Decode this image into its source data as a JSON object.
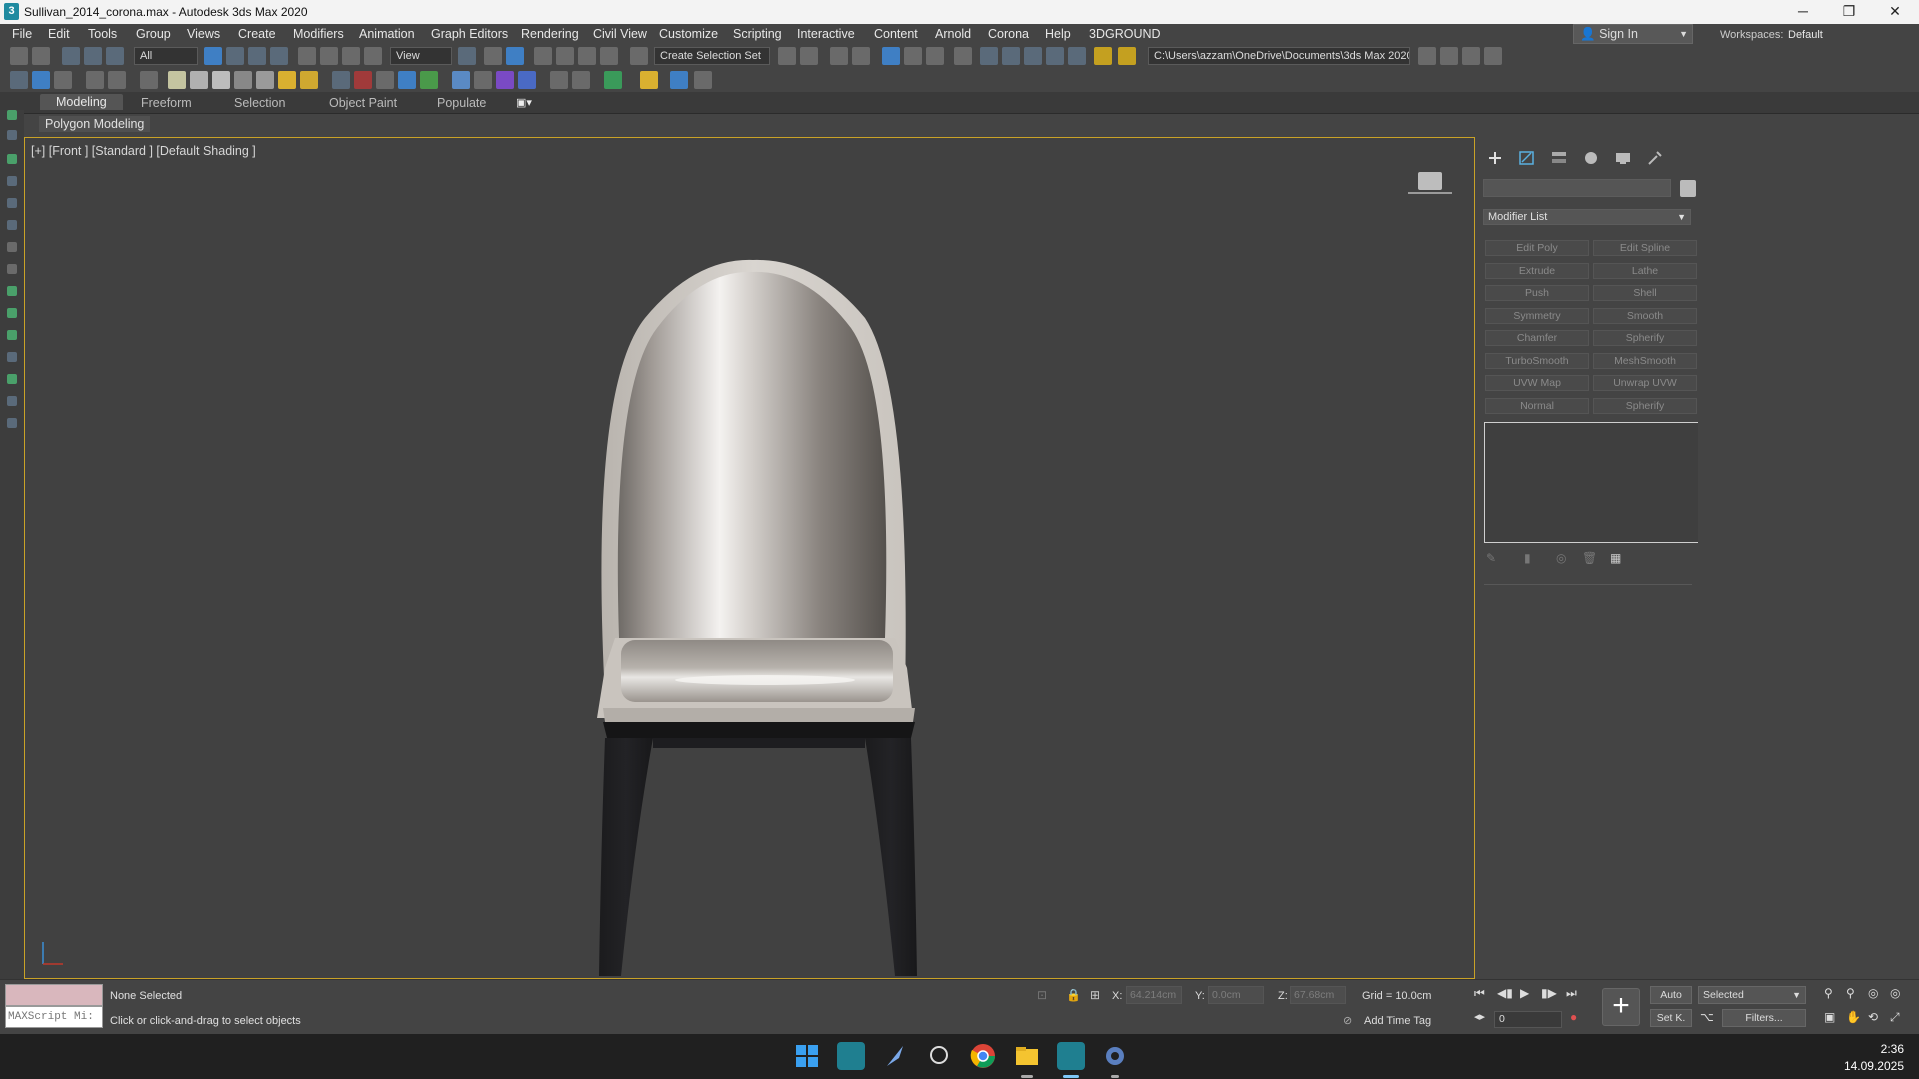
{
  "window": {
    "title": "Sullivan_2014_corona.max - Autodesk 3ds Max 2020",
    "minimize_glyph": "─",
    "restore_glyph": "❐",
    "close_glyph": "✕"
  },
  "menus": [
    "File",
    "Edit",
    "Tools",
    "Group",
    "Views",
    "Create",
    "Modifiers",
    "Animation",
    "Graph Editors",
    "Rendering",
    "Civil View",
    "Customize",
    "Scripting",
    "Interactive",
    "Content",
    "Arnold",
    "Corona",
    "Help",
    "3DGROUND"
  ],
  "account": {
    "sign_in": "Sign In"
  },
  "workspaces": {
    "label": "Workspaces:",
    "value": "Default"
  },
  "toolbar": {
    "selection_filter": "All",
    "ref_coord": "View",
    "named_selection": "Create Selection Set",
    "project_path": "C:\\Users\\azzam\\OneDrive\\Documents\\3ds Max 2020"
  },
  "ribbon": {
    "tabs": [
      "Modeling",
      "Freeform",
      "Selection",
      "Object Paint",
      "Populate"
    ],
    "active_tab": "Modeling",
    "panel_label": "Polygon Modeling"
  },
  "viewport": {
    "label": "[+] [Front ] [Standard ] [Default Shading ]",
    "axis_colors": {
      "y": "#3a8fd6",
      "x": "#c0392b"
    }
  },
  "command_panel": {
    "modifier_list": "Modifier List",
    "modifiers": [
      [
        "Edit Poly",
        "Edit Spline"
      ],
      [
        "Extrude",
        "Lathe"
      ],
      [
        "Push",
        "Shell"
      ],
      [
        "Symmetry",
        "Smooth"
      ],
      [
        "Chamfer",
        "Spherify"
      ],
      [
        "TurboSmooth",
        "MeshSmooth"
      ],
      [
        "UVW Map",
        "Unwrap UVW"
      ],
      [
        "Normal",
        "Spherify"
      ]
    ]
  },
  "status": {
    "maxscript_label": "MAXScript Mi:",
    "selection": "None Selected",
    "prompt": "Click or click-and-drag to select objects",
    "x_label": "X:",
    "x_value": "64.214cm",
    "y_label": "Y:",
    "y_value": "0.0cm",
    "z_label": "Z:",
    "z_value": "67.68cm",
    "grid": "Grid = 10.0cm",
    "add_time_tag": "Add Time Tag",
    "auto_key": "Auto",
    "set_key": "Set K.",
    "key_filter_select": "Selected",
    "filters": "Filters...",
    "frame": "0"
  },
  "taskbar": {
    "time": "2:36",
    "date": "14.09.2025"
  }
}
